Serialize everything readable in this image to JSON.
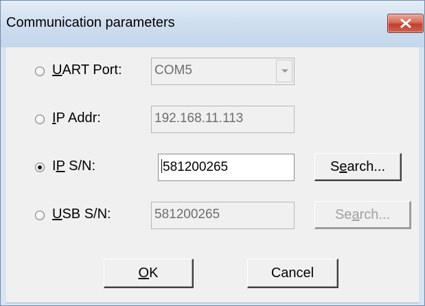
{
  "window": {
    "title": "Communication parameters"
  },
  "options": {
    "uart": {
      "label_hot": "U",
      "label_rest": "ART Port:",
      "selected": false,
      "value": "COM5"
    },
    "ip_addr": {
      "label_hot": "I",
      "label_rest": "P Addr:",
      "selected": false,
      "value": "192.168.11.113"
    },
    "ip_sn": {
      "label_pre": "I",
      "label_hot": "P",
      "label_rest": " S/N:",
      "selected": true,
      "value": "581200265",
      "search_pre": "S",
      "search_hot": "e",
      "search_rest": "arch..."
    },
    "usb_sn": {
      "label_hot": "U",
      "label_rest": "SB S/N:",
      "selected": false,
      "value": "581200265",
      "search_pre": "Se",
      "search_hot": "a",
      "search_rest": "rch..."
    }
  },
  "buttons": {
    "ok_hot": "O",
    "ok_rest": "K",
    "cancel": "Cancel"
  }
}
